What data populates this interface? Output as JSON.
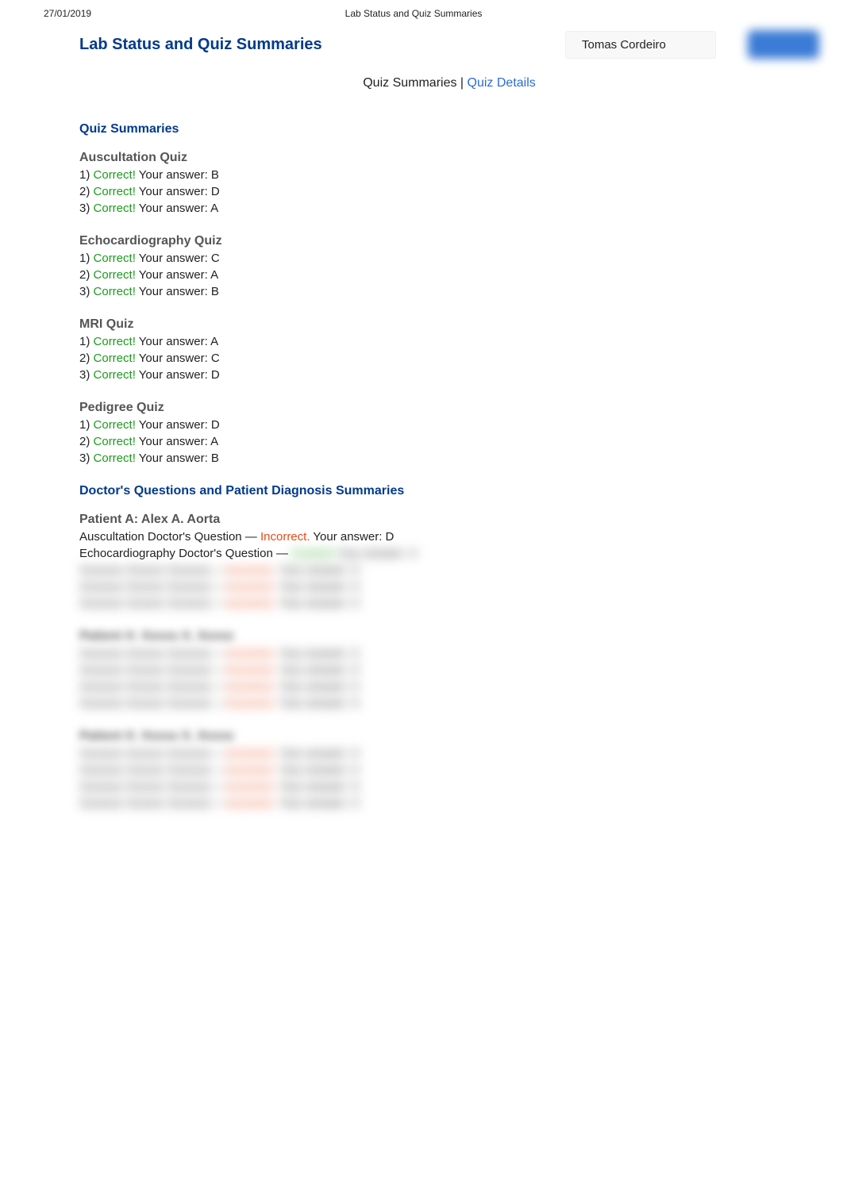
{
  "meta": {
    "date": "27/01/2019",
    "doc_title": "Lab Status and Quiz Summaries"
  },
  "header": {
    "page_title": "Lab Status and Quiz Summaries",
    "user_name": "Tomas Cordeiro"
  },
  "tabs": {
    "active_label": "Quiz Summaries",
    "separator": " | ",
    "link_label": "Quiz Details"
  },
  "sections": {
    "quiz_summaries_title": "Quiz Summaries",
    "diagnosis_title": "Doctor's Questions and Patient Diagnosis Summaries"
  },
  "quizzes": [
    {
      "title": "Auscultation Quiz",
      "lines": [
        {
          "n": "1)",
          "status": "Correct!",
          "rest": " Your answer: B"
        },
        {
          "n": "2)",
          "status": "Correct!",
          "rest": " Your answer: D"
        },
        {
          "n": "3)",
          "status": "Correct!",
          "rest": " Your answer: A"
        }
      ]
    },
    {
      "title": "Echocardiography Quiz",
      "lines": [
        {
          "n": "1)",
          "status": "Correct!",
          "rest": " Your answer: C"
        },
        {
          "n": "2)",
          "status": "Correct!",
          "rest": " Your answer: A"
        },
        {
          "n": "3)",
          "status": "Correct!",
          "rest": " Your answer: B"
        }
      ]
    },
    {
      "title": "MRI Quiz",
      "lines": [
        {
          "n": "1)",
          "status": "Correct!",
          "rest": " Your answer: A"
        },
        {
          "n": "2)",
          "status": "Correct!",
          "rest": " Your answer: C"
        },
        {
          "n": "3)",
          "status": "Correct!",
          "rest": " Your answer: D"
        }
      ]
    },
    {
      "title": "Pedigree Quiz",
      "lines": [
        {
          "n": "1)",
          "status": "Correct!",
          "rest": " Your answer: D"
        },
        {
          "n": "2)",
          "status": "Correct!",
          "rest": " Your answer: A"
        },
        {
          "n": "3)",
          "status": "Correct!",
          "rest": " Your answer: B"
        }
      ]
    }
  ],
  "patients": [
    {
      "title": "Patient A: Alex A. Aorta",
      "blurred": false,
      "lines": [
        {
          "pre": "Auscultation Doctor's Question — ",
          "status": "Incorrect.",
          "status_class": "incorrect",
          "rest": " Your answer: D",
          "blurred": false
        },
        {
          "pre": "Echocardiography Doctor's Question — ",
          "status": "",
          "status_class": "",
          "rest": "",
          "blurred": true
        },
        {
          "pre": "",
          "status": "",
          "status_class": "",
          "rest": "",
          "blurred": true
        },
        {
          "pre": "",
          "status": "",
          "status_class": "",
          "rest": "",
          "blurred": true
        },
        {
          "pre": "",
          "status": "",
          "status_class": "",
          "rest": "",
          "blurred": true
        }
      ]
    },
    {
      "title": "",
      "blurred": true,
      "lines": [
        {
          "pre": "",
          "status": "",
          "status_class": "",
          "rest": "",
          "blurred": true
        },
        {
          "pre": "",
          "status": "",
          "status_class": "",
          "rest": "",
          "blurred": true
        },
        {
          "pre": "",
          "status": "",
          "status_class": "",
          "rest": "",
          "blurred": true
        },
        {
          "pre": "",
          "status": "",
          "status_class": "",
          "rest": "",
          "blurred": true
        }
      ]
    },
    {
      "title": "",
      "blurred": true,
      "lines": [
        {
          "pre": "",
          "status": "",
          "status_class": "",
          "rest": "",
          "blurred": true
        },
        {
          "pre": "",
          "status": "",
          "status_class": "",
          "rest": "",
          "blurred": true
        },
        {
          "pre": "",
          "status": "",
          "status_class": "",
          "rest": "",
          "blurred": true
        },
        {
          "pre": "",
          "status": "",
          "status_class": "",
          "rest": "",
          "blurred": true
        }
      ]
    }
  ]
}
